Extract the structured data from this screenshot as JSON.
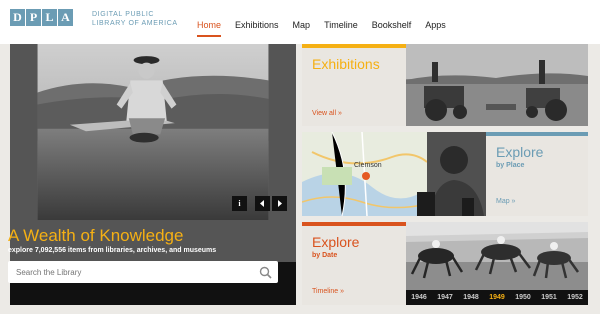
{
  "logo": {
    "letters": [
      "D",
      "P",
      "L",
      "A"
    ],
    "tagline": "DIGITAL PUBLIC LIBRARY OF AMERICA"
  },
  "nav": [
    {
      "label": "Home",
      "active": true
    },
    {
      "label": "Exhibitions",
      "active": false
    },
    {
      "label": "Map",
      "active": false
    },
    {
      "label": "Timeline",
      "active": false
    },
    {
      "label": "Bookshelf",
      "active": false
    },
    {
      "label": "Apps",
      "active": false
    }
  ],
  "hero": {
    "title": "A Wealth of Knowledge",
    "subtitle": "explore 7,092,556 items from libraries, archives, and museums",
    "search_placeholder": "Search the Library",
    "info_label": "i"
  },
  "tiles": {
    "exhibitions": {
      "title": "Exhibitions",
      "link": "View all »"
    },
    "place": {
      "title": "Explore",
      "sub": "by Place",
      "link": "Map »",
      "map_label": "Clemson"
    },
    "date": {
      "title": "Explore",
      "sub": "by Date",
      "link": "Timeline »"
    }
  },
  "years": [
    "1946",
    "1947",
    "1948",
    "1949",
    "1950",
    "1951",
    "1952"
  ],
  "selected_year": "1949",
  "colors": {
    "accent": "#d9531e",
    "gold": "#f5b014",
    "blue": "#6b9cb4"
  }
}
